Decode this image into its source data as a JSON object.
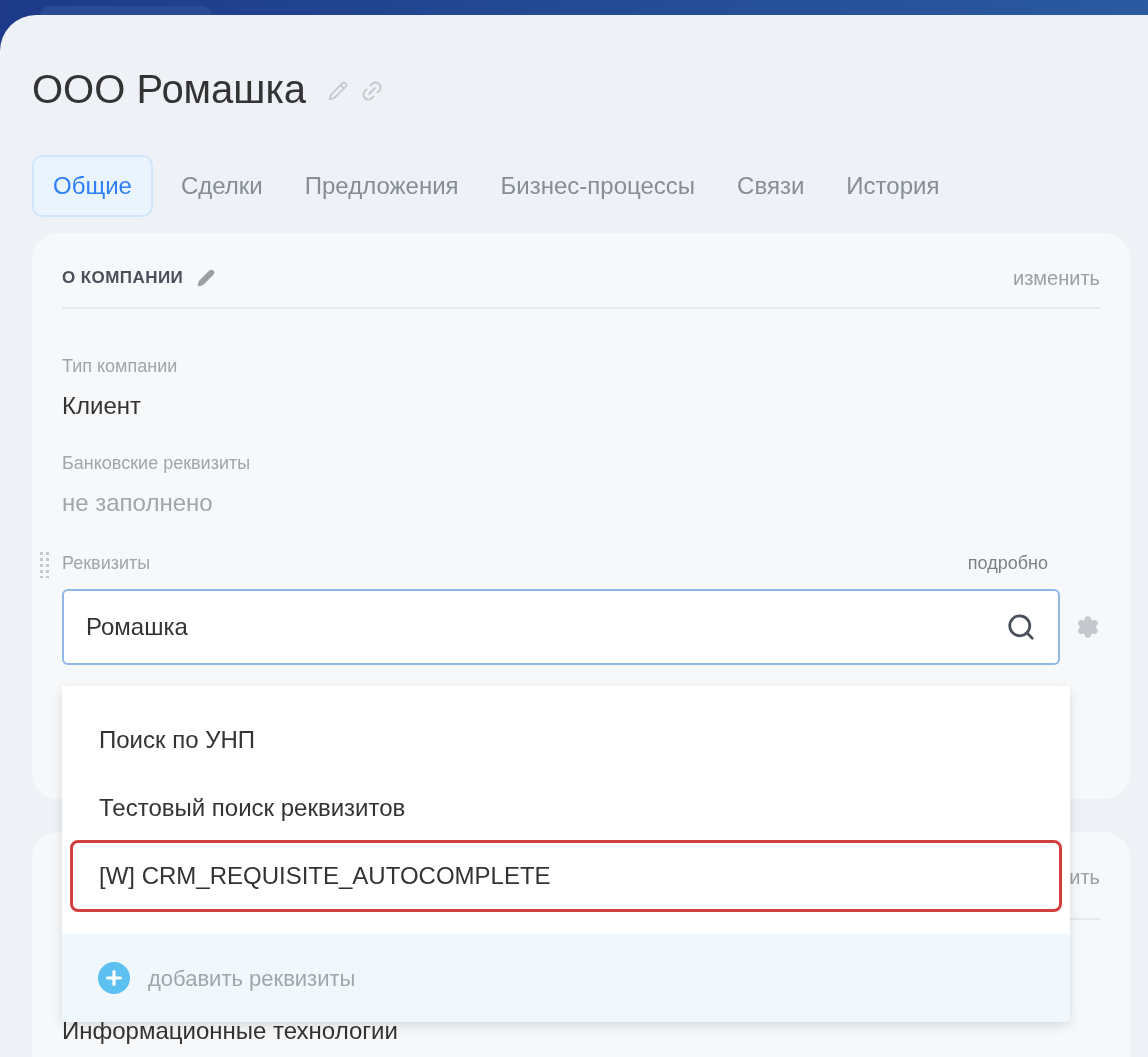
{
  "title": "ООО Ромашка",
  "tabs": [
    {
      "label": "Общие",
      "selected": true
    },
    {
      "label": "Сделки",
      "selected": false
    },
    {
      "label": "Предложения",
      "selected": false
    },
    {
      "label": "Бизнес-процессы",
      "selected": false
    },
    {
      "label": "Связи",
      "selected": false
    },
    {
      "label": "История",
      "selected": false
    }
  ],
  "about_card": {
    "heading": "О КОМПАНИИ",
    "edit_link": "изменить",
    "fields": [
      {
        "label": "Тип компании",
        "value": "Клиент",
        "empty": false
      },
      {
        "label": "Банковские реквизиты",
        "value": "не заполнено",
        "empty": true
      }
    ],
    "requisites": {
      "label": "Реквизиты",
      "details_link": "подробно",
      "search_value": "Ромашка"
    }
  },
  "dropdown": {
    "items": [
      {
        "label": "Поиск по УНП",
        "highlighted": false
      },
      {
        "label": "Тестовый поиск реквизитов",
        "highlighted": false
      },
      {
        "label": "[W] CRM_REQUISITE_AUTOCOMPLETE",
        "highlighted": true
      }
    ],
    "add_action": "добавить реквизиты"
  },
  "second_card": {
    "edit_link": "ить",
    "value": "Информационные технологии"
  }
}
